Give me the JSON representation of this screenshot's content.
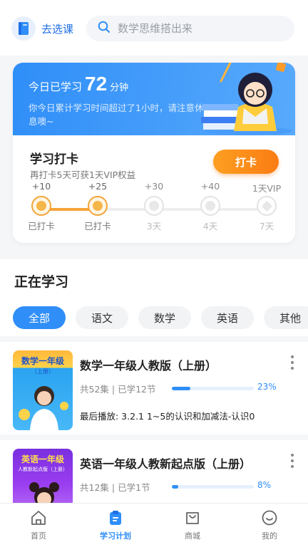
{
  "header": {
    "select_course_label": "去选课",
    "search_placeholder": "数学思维搭出来"
  },
  "study_today": {
    "label": "今日已学习",
    "minutes": "72",
    "unit": "分钟",
    "tip": "你今日累计学习时间超过了1小时，请注意休息噢~"
  },
  "checkin": {
    "title": "学习打卡",
    "subtitle": "再打卡5天可获1天VIP权益",
    "button_label": "打卡",
    "progress_fraction": 0.25,
    "steps": [
      {
        "reward": "+10",
        "status": "已打卡",
        "done": true
      },
      {
        "reward": "+25",
        "status": "已打卡",
        "done": true
      },
      {
        "reward": "+30",
        "status": "3天",
        "done": false
      },
      {
        "reward": "+40",
        "status": "4天",
        "done": false
      },
      {
        "reward": "1天VIP",
        "status": "7天",
        "done": false
      }
    ]
  },
  "studying": {
    "title": "正在学习",
    "tabs": [
      "全部",
      "语文",
      "数学",
      "英语",
      "其他"
    ],
    "active_tab": "全部"
  },
  "courses": [
    {
      "thumb_title": "数学一年级",
      "thumb_sub": "（上册）",
      "title": "数学一年级人教版（上册）",
      "meta": "共52集 | 已学12节",
      "progress_pct": 23,
      "progress_label": "23%",
      "last_play": "最后播放: 3.2.1 1~5的认识和加减法-认识0"
    },
    {
      "thumb_title": "英语一年级",
      "thumb_sub": "人教新起点版（上册）",
      "title": "英语一年级人教新起点版（上册）",
      "meta": "共12集 | 已学1节",
      "progress_pct": 8,
      "progress_label": "8%",
      "last_play": ""
    }
  ],
  "nav": {
    "items": [
      {
        "label": "首页",
        "icon": "home-icon"
      },
      {
        "label": "学习计划",
        "icon": "clipboard-icon"
      },
      {
        "label": "商城",
        "icon": "shopping-bag-icon"
      },
      {
        "label": "我的",
        "icon": "smile-icon"
      }
    ],
    "active": "学习计划"
  },
  "colors": {
    "primary": "#2f8ef8",
    "accent_orange": "#fb7c13",
    "checked_gold": "#f3a43a"
  }
}
